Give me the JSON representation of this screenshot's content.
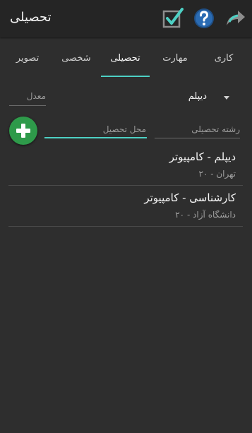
{
  "appbar": {
    "title": "تحصیلی",
    "icons": [
      "checkbox-icon",
      "help-icon",
      "share-icon"
    ],
    "accent": "#4dd0c4"
  },
  "tabs": [
    {
      "label": "کاری",
      "active": false
    },
    {
      "label": "مهارت",
      "active": false
    },
    {
      "label": "تحصیلی",
      "active": true
    },
    {
      "label": "شخصی",
      "active": false
    },
    {
      "label": "تصویر",
      "active": false
    }
  ],
  "form": {
    "degree_value": "دیپلم",
    "gpa_placeholder": "معدل",
    "field_placeholder": "رشته تحصیلی",
    "place_placeholder": "محل تحصیل"
  },
  "items": [
    {
      "title": "دیپلم - کامپیوتر",
      "subtitle": "تهران - ۲۰"
    },
    {
      "title": "کارشناسی - کامپیوتر",
      "subtitle": "دانشگاه آزاد - ۲۰"
    }
  ],
  "colors": {
    "background": "#2e2e2e",
    "appbar": "#252525",
    "add_button": "#2e9a4a"
  }
}
